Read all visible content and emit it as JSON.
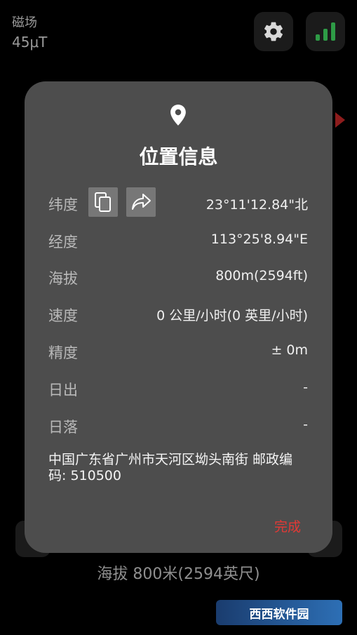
{
  "header": {
    "title": "磁场",
    "value": "45μT"
  },
  "icons": {
    "settings": "gear-icon",
    "signal": "signal-bars-icon",
    "location": "location-pin-icon",
    "copy": "copy-icon",
    "share": "share-icon"
  },
  "colors": {
    "accent": "#e53935",
    "signal": "#2e9b46",
    "dialog_bg": "#4d4d4d"
  },
  "dialog": {
    "title": "位置信息",
    "rows": [
      {
        "label": "纬度",
        "value": "23°11'12.84\"北"
      },
      {
        "label": "经度",
        "value": "113°25'8.94\"E"
      },
      {
        "label": "海拔",
        "value": "800m(2594ft)"
      },
      {
        "label": "速度",
        "value": "0 公里/小时(0 英里/小时)"
      },
      {
        "label": "精度",
        "value": "± 0m"
      },
      {
        "label": "日出",
        "value": "-"
      },
      {
        "label": "日落",
        "value": "-"
      }
    ],
    "address": "中国广东省广州市天河区坳头南街 邮政编码: 510500",
    "done_label": "完成"
  },
  "footer": {
    "altitude_text": "海拔 800米(2594英尺)"
  },
  "watermark": {
    "text": "西西软件园"
  }
}
